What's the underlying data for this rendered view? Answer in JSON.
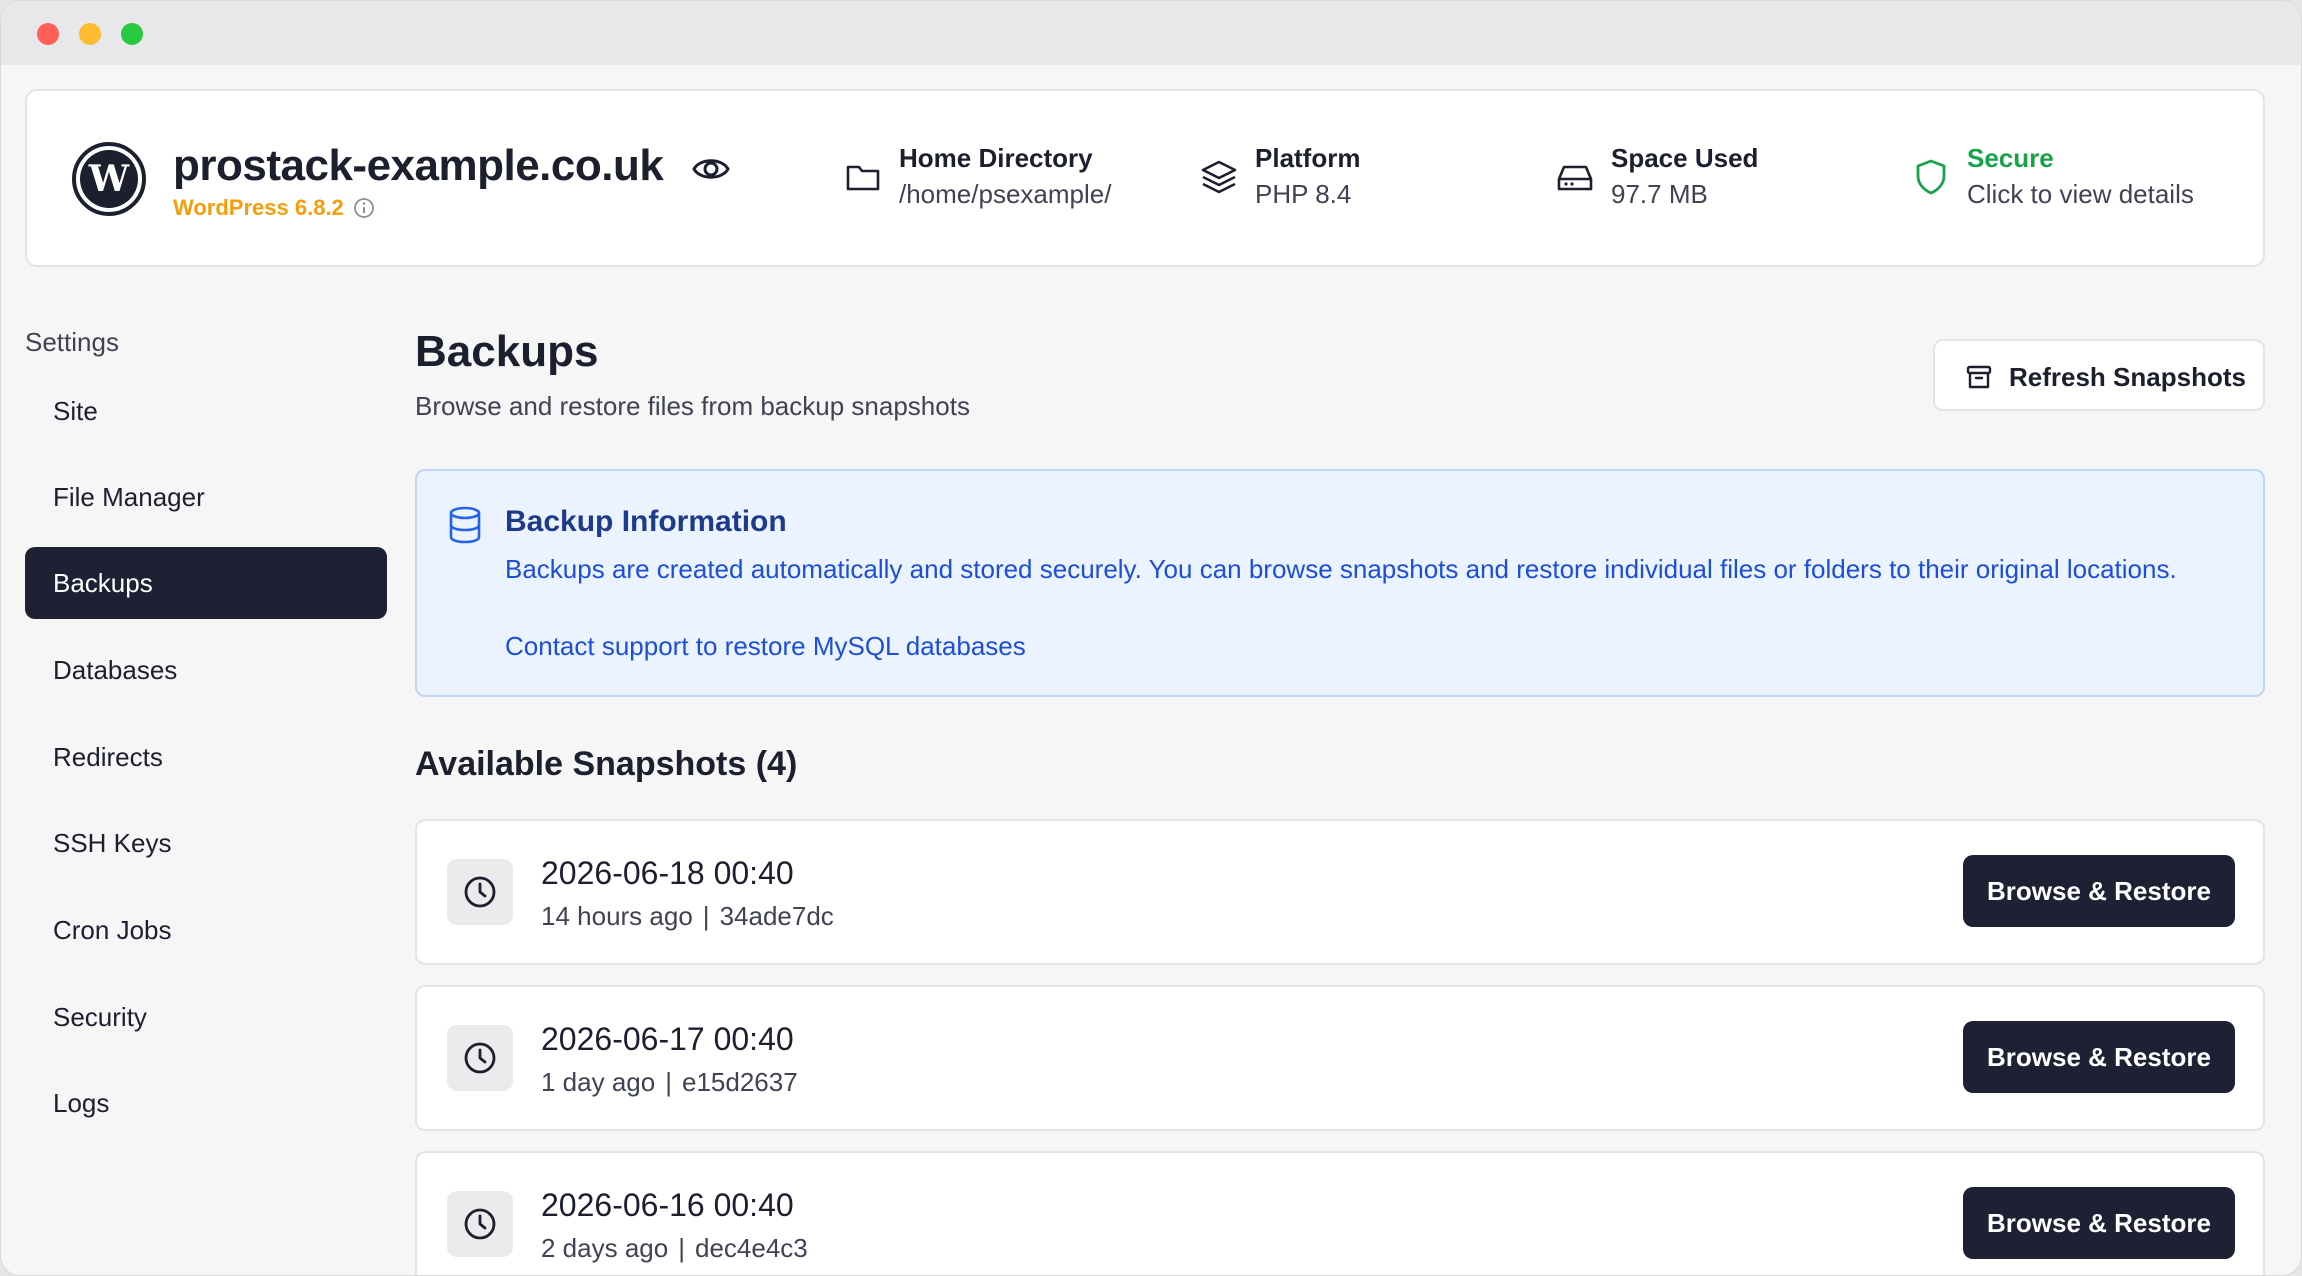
{
  "site": {
    "name": "prostack-example.co.uk",
    "cms_version": "WordPress 6.8.2",
    "meta": {
      "home": {
        "label": "Home Directory",
        "value": "/home/psexample/"
      },
      "platform": {
        "label": "Platform",
        "value": "PHP 8.4"
      },
      "space": {
        "label": "Space Used",
        "value": "97.7 MB"
      },
      "secure": {
        "label": "Secure",
        "value": "Click to view details"
      }
    },
    "colors": {
      "accent_dark": "#1e2034",
      "wp_version": "#f59e0b",
      "secure": "#16a34a",
      "info_text": "#1d4ed8"
    }
  },
  "sidebar": {
    "title": "Settings",
    "items": [
      {
        "label": "Site"
      },
      {
        "label": "File Manager"
      },
      {
        "label": "Backups",
        "active": true
      },
      {
        "label": "Databases"
      },
      {
        "label": "Redirects"
      },
      {
        "label": "SSH Keys"
      },
      {
        "label": "Cron Jobs"
      },
      {
        "label": "Security"
      },
      {
        "label": "Logs"
      }
    ]
  },
  "main": {
    "title": "Backups",
    "subtitle": "Browse and restore files from backup snapshots",
    "refresh_label": "Refresh Snapshots",
    "info": {
      "title": "Backup Information",
      "text": "Backups are created automatically and stored securely. You can browse snapshots and restore individual files or folders to their original locations.",
      "link": "Contact support to restore MySQL databases"
    },
    "snapshots_heading": "Available Snapshots (4)",
    "snapshots": [
      {
        "date": "2026-06-18 00:40",
        "ago": "14 hours ago",
        "sep": "|",
        "id": "34ade7dc",
        "action": "Browse & Restore"
      },
      {
        "date": "2026-06-17 00:40",
        "ago": "1 day ago",
        "sep": "|",
        "id": "e15d2637",
        "action": "Browse & Restore"
      },
      {
        "date": "2026-06-16 00:40",
        "ago": "2 days ago",
        "sep": "|",
        "id": "dec4e4c3",
        "action": "Browse & Restore"
      }
    ]
  },
  "icons": {
    "logo": "wordpress-logo-icon",
    "visibility": "eye-icon",
    "info": "info-icon",
    "home": "folder-icon",
    "platform": "layers-icon",
    "space": "hard-drive-icon",
    "secure": "shield-icon",
    "refresh": "archive-icon",
    "info_box": "database-icon",
    "snapshot": "clock-icon"
  }
}
